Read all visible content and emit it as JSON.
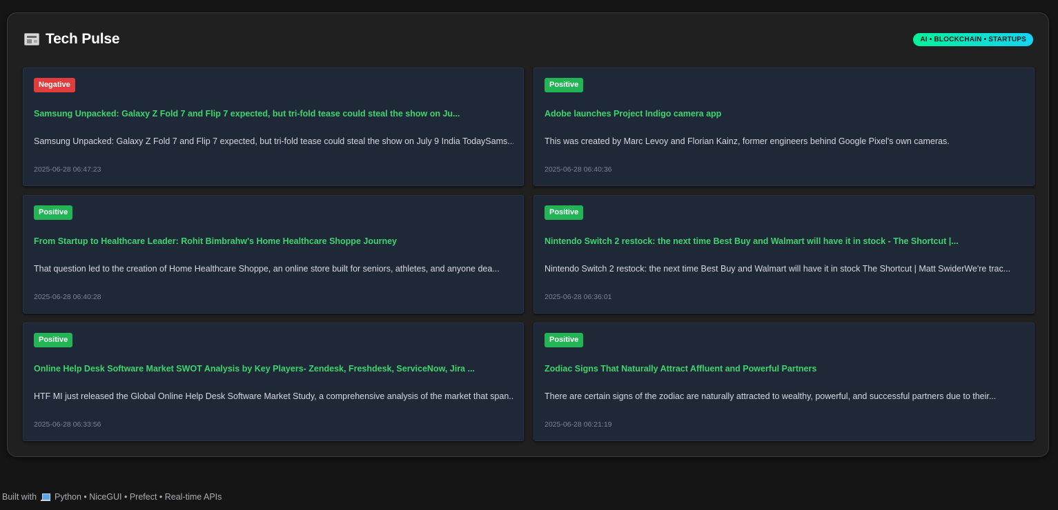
{
  "header": {
    "icon": "newspaper-icon",
    "title": "Tech Pulse",
    "topics": "AI • BLOCKCHAIN • STARTUPS"
  },
  "colors": {
    "positive": "#22b455",
    "negative": "#e23d3d",
    "title_green": "#3fd46f",
    "card_bg": "#1f2837"
  },
  "articles": [
    {
      "sentiment": "Negative",
      "title": "Samsung Unpacked: Galaxy Z Fold 7 and Flip 7 expected, but tri-fold tease could steal the show on Ju...",
      "summary": "Samsung Unpacked: Galaxy Z Fold 7 and Flip 7 expected, but tri-fold tease could steal the show on July 9 India TodaySams...",
      "time": "2025-06-28 06:47:23"
    },
    {
      "sentiment": "Positive",
      "title": "Adobe launches Project Indigo camera app",
      "summary": "This was created by Marc Levoy and Florian Kainz, former engineers behind Google Pixel's own cameras.",
      "time": "2025-06-28 06:40:36"
    },
    {
      "sentiment": "Positive",
      "title": "From Startup to Healthcare Leader: Rohit Bimbrahw's Home Healthcare Shoppe Journey",
      "summary": "That question led to the creation of Home Healthcare Shoppe, an online store built for seniors, athletes, and anyone dea...",
      "time": "2025-06-28 06:40:28"
    },
    {
      "sentiment": "Positive",
      "title": "Nintendo Switch 2 restock: the next time Best Buy and Walmart will have it in stock - The Shortcut |...",
      "summary": "Nintendo Switch 2 restock: the next time Best Buy and Walmart will have it in stock The Shortcut | Matt SwiderWe're trac...",
      "time": "2025-06-28 06:36:01"
    },
    {
      "sentiment": "Positive",
      "title": "Online Help Desk Software Market SWOT Analysis by Key Players- Zendesk, Freshdesk, ServiceNow, Jira ...",
      "summary": "HTF MI just released the Global Online Help Desk Software Market Study, a comprehensive analysis of the market that span...",
      "time": "2025-06-28 06:33:56"
    },
    {
      "sentiment": "Positive",
      "title": "Zodiac Signs That Naturally Attract Affluent and Powerful Partners",
      "summary": "There are certain signs of the zodiac are naturally attracted to wealthy, powerful, and successful partners due to their...",
      "time": "2025-06-28 06:21:19"
    }
  ],
  "footer": {
    "prefix": "Built with",
    "icon": "laptop-icon",
    "suffix": "Python • NiceGUI • Prefect • Real-time APIs"
  }
}
